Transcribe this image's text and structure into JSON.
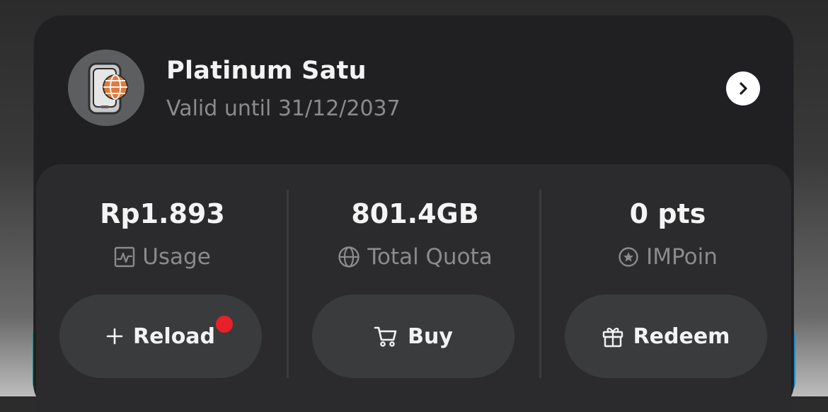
{
  "plan": {
    "name": "Platinum Satu",
    "valid_until": "Valid until 31/12/2037"
  },
  "stats": [
    {
      "value": "Rp1.893",
      "label": "Usage",
      "icon": "activity-chart-icon"
    },
    {
      "value": "801.4GB",
      "label": "Total Quota",
      "icon": "globe-icon"
    },
    {
      "value": "0 pts",
      "label": "IMPoin",
      "icon": "star-circle-icon"
    }
  ],
  "actions": [
    {
      "label": "Reload",
      "icon": "plus-icon",
      "has_notification": true
    },
    {
      "label": "Buy",
      "icon": "cart-icon"
    },
    {
      "label": "Redeem",
      "icon": "gift-icon"
    }
  ],
  "colors": {
    "card_bg": "#202022",
    "panel_bg": "#2b2b2d",
    "button_bg": "#3a3b3d",
    "notification_dot": "#e8202a",
    "globe_accent": "#e07a3e"
  }
}
